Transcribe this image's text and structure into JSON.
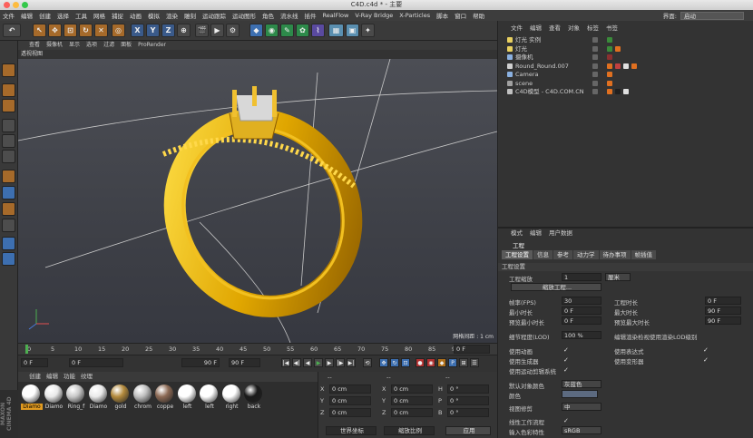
{
  "window": {
    "title": "C4D.c4d * - 主要"
  },
  "menu": {
    "items": [
      "文件",
      "编辑",
      "创建",
      "选择",
      "工具",
      "网格",
      "捕捉",
      "动画",
      "模拟",
      "渲染",
      "雕刻",
      "运动跟踪",
      "运动图形",
      "角色",
      "流水线",
      "插件",
      "RealFlow",
      "V-Ray Bridge",
      "X-Particles",
      "脚本",
      "窗口",
      "帮助"
    ],
    "layout_label": "界面:",
    "layout_value": "启动"
  },
  "toolbar": {
    "axis_x": "X",
    "axis_y": "Y",
    "axis_z": "Z"
  },
  "viewport": {
    "menu": [
      "查看",
      "摄像机",
      "显示",
      "选项",
      "过滤",
      "面板",
      "ProRender"
    ],
    "label": "透视视图",
    "grid_spacing": "网格间距 : 1 cm"
  },
  "timeline": {
    "ticks": [
      "0",
      "5",
      "10",
      "15",
      "20",
      "25",
      "30",
      "35",
      "40",
      "45",
      "50",
      "55",
      "60",
      "65",
      "70",
      "75",
      "80",
      "85",
      "90"
    ],
    "current_frame": "0 F"
  },
  "playback": {
    "start": "0 F",
    "min": "0 F",
    "max": "90 F",
    "end": "90 F"
  },
  "materials": {
    "menu": [
      "创建",
      "编辑",
      "功能",
      "纹理"
    ],
    "items": [
      {
        "label": "Diamo",
        "color": "#ffffff",
        "selected": true
      },
      {
        "label": "Diamo",
        "color": "#e9e9e9"
      },
      {
        "label": "Ring_f",
        "color": "#c8c8c8"
      },
      {
        "label": "Diamo",
        "color": "#eaeaea"
      },
      {
        "label": "gold",
        "color": "#b38a3c"
      },
      {
        "label": "chrom",
        "color": "#c0c0c0"
      },
      {
        "label": "coppe",
        "color": "#8c6a55"
      },
      {
        "label": "left",
        "color": "#ffffff"
      },
      {
        "label": "left",
        "color": "#ffffff"
      },
      {
        "label": "right",
        "color": "#ffffff"
      },
      {
        "label": "back",
        "color": "#1a1a1a"
      }
    ],
    "brand": "MAXON CINEMA 4D"
  },
  "coords": {
    "header1": "--",
    "header2": "--",
    "header3": "--",
    "rows": [
      [
        "X",
        "0 cm",
        "X",
        "0 cm",
        "H",
        "0 °"
      ],
      [
        "Y",
        "0 cm",
        "Y",
        "0 cm",
        "P",
        "0 °"
      ],
      [
        "Z",
        "0 cm",
        "Z",
        "0 cm",
        "B",
        "0 °"
      ]
    ],
    "world": "世界坐标",
    "scale": "缩放比例",
    "apply": "应用"
  },
  "objects": {
    "menu": [
      "文件",
      "编辑",
      "查看",
      "对象",
      "标签",
      "书签"
    ],
    "rows": [
      {
        "name": "灯光 实例"
      },
      {
        "name": "灯光"
      },
      {
        "name": "摄像机"
      },
      {
        "name": "Round_Round.007"
      },
      {
        "name": "Camera"
      },
      {
        "name": "scene"
      },
      {
        "name": "C4D模型 - C4D.COM.CN"
      }
    ]
  },
  "attributes": {
    "menu": [
      "模式",
      "编辑",
      "用户数据"
    ],
    "title": "工程",
    "tabs": [
      "工程设置",
      "信息",
      "参考",
      "动力学",
      "待办事项",
      "帧插值"
    ],
    "section": "工程设置",
    "scale_label": "工程缩放",
    "scale_value": "1",
    "scale_unit": "厘米",
    "scale_button": "缩放工程...",
    "fps_label": "帧率(FPS)",
    "fps": "30",
    "time_label": "工程时长",
    "time": "0 F",
    "min_label": "最小时长",
    "min": "0 F",
    "max_label": "最大时长",
    "max": "90 F",
    "pmin_label": "预览最小时长",
    "pmin": "0 F",
    "pmax_label": "预览最大时长",
    "pmax": "90 F",
    "lod_label": "细节程度(LOD)",
    "lod": "100 %",
    "lod_note": "编辑渲染检视使用渲染LOD级别",
    "anim_label": "使用动画",
    "expr_label": "使用表达式",
    "gen_label": "使用生成器",
    "deform_label": "使用变形器",
    "motion_label": "使用运动剪辑系统",
    "defcolor_label": "默认对象颜色",
    "defcolor": "灰蓝色",
    "color_label": "颜色",
    "clip_label": "视图修剪",
    "clip": "中",
    "linear_label": "线性工作流程",
    "input_label": "输入色彩特性",
    "input": "sRGB"
  }
}
